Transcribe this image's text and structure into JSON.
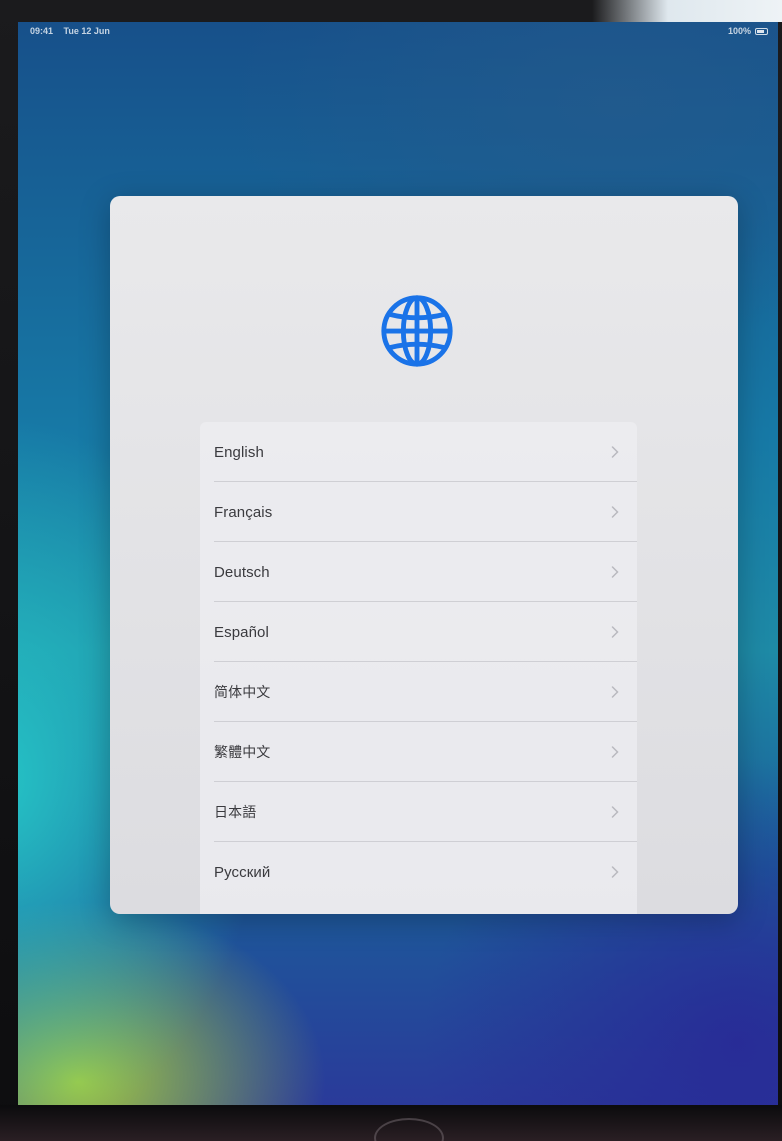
{
  "status_bar": {
    "time": "09:41",
    "date": "Tue 12 Jun",
    "battery": "100%"
  },
  "setup": {
    "icon": "globe-icon",
    "accent_color": "#1a73e8",
    "languages": [
      {
        "label": "English"
      },
      {
        "label": "Français"
      },
      {
        "label": "Deutsch"
      },
      {
        "label": "Español"
      },
      {
        "label": "简体中文"
      },
      {
        "label": "繁體中文"
      },
      {
        "label": "日本語"
      },
      {
        "label": "Русский"
      }
    ]
  }
}
